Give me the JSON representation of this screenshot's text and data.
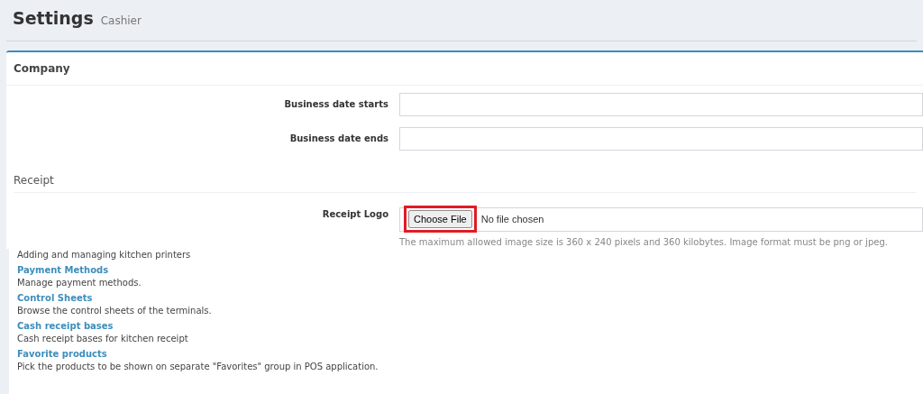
{
  "header": {
    "title": "Settings",
    "subtitle": "Cashier"
  },
  "panel": {
    "title": "Company",
    "fields": [
      {
        "label": "Business date starts",
        "kind": "text"
      },
      {
        "label": "Business date ends",
        "kind": "text"
      }
    ],
    "section": "Receipt",
    "file_field": {
      "label": "Receipt Logo",
      "button": "Choose File",
      "status": "No file chosen",
      "highlighted": true,
      "help": "The maximum allowed image size is 360 x 240 pixels and 360 kilobytes. Image format must be png or jpeg."
    }
  },
  "links": [
    {
      "description": "Adding and managing kitchen printers"
    },
    {
      "title": "Payment Methods",
      "description": "Manage payment methods."
    },
    {
      "title": "Control Sheets",
      "description": "Browse the control sheets of the terminals."
    },
    {
      "title": "Cash receipt bases",
      "description": "Cash receipt bases for kitchen receipt"
    },
    {
      "title": "Favorite products",
      "description": "Pick the products to be shown on separate \"Favorites\" group in POS application."
    }
  ]
}
